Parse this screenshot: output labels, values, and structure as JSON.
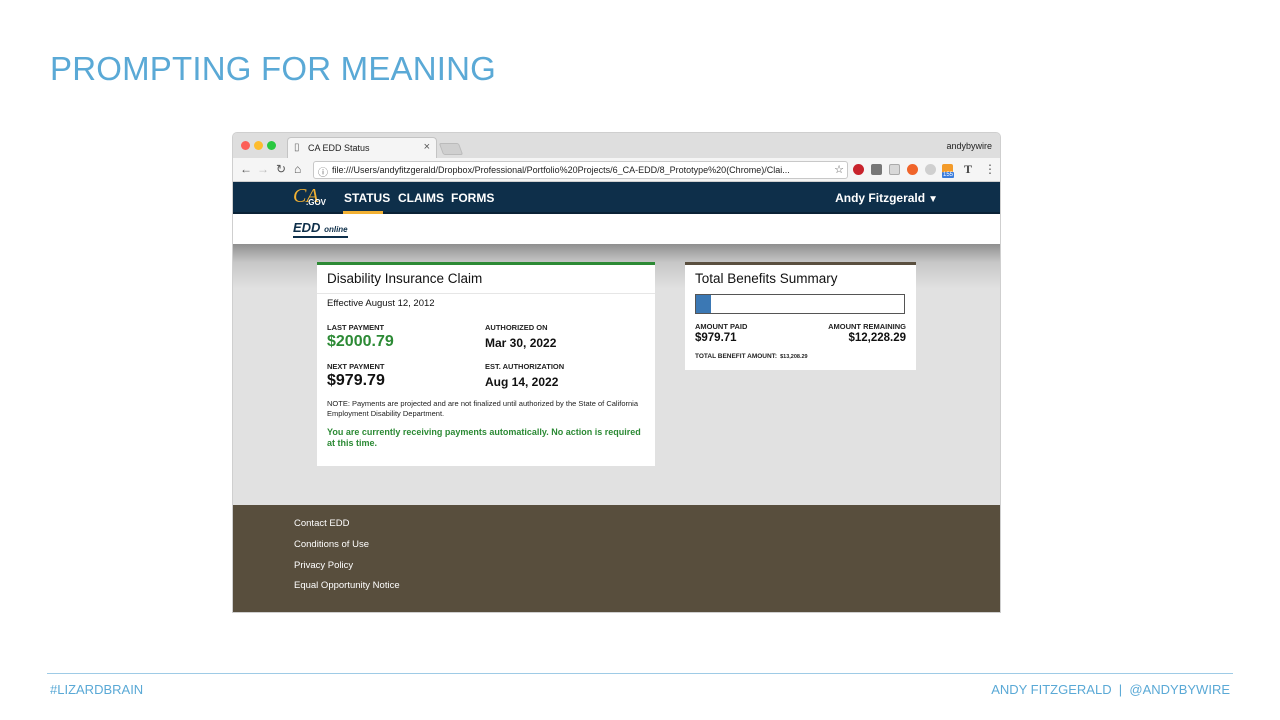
{
  "slide": {
    "title": "PROMPTING FOR MEANING",
    "footer_left": "#LIZARDBRAIN",
    "footer_right": "ANDY FITZGERALD  |  @ANDYBYWIRE"
  },
  "browser": {
    "tab_title": "CA EDD Status",
    "tab_close": "×",
    "profile_name": "andybywire",
    "url": "file:///Users/andyfitzgerald/Dropbox/Professional/Portfolio%20Projects/6_CA-EDD/8_Prototype%20(Chrome)/Clai...",
    "ext_badge": "155"
  },
  "site": {
    "logo_ca": "CA",
    "logo_gov": ".GOV",
    "nav": {
      "status": "STATUS",
      "claims": "CLAIMS",
      "forms": "FORMS"
    },
    "user_name": "Andy Fitzgerald",
    "edd_logo": "EDD",
    "edd_logo_suffix": "online"
  },
  "claim_card": {
    "title": "Disability Insurance Claim",
    "effective": "Effective August 12, 2012",
    "last_payment_label": "LAST PAYMENT",
    "last_payment_value": "$2000.79",
    "authorized_on_label": "AUTHORIZED ON",
    "authorized_on_value": "Mar 30, 2022",
    "next_payment_label": "NEXT PAYMENT",
    "next_payment_value": "$979.79",
    "est_auth_label": "EST. AUTHORIZATION",
    "est_auth_value": "Aug 14, 2022",
    "note": "NOTE: Payments are projected and are not finalized until authorized by the State of California Employment Disability Department.",
    "auto_message": "You are currently receiving payments automatically. No action is required at this time."
  },
  "benefits_card": {
    "title": "Total Benefits Summary",
    "progress_fraction": 0.074,
    "amount_paid_label": "AMOUNT PAID",
    "amount_paid_value": "$979.71",
    "amount_remaining_label": "AMOUNT REMAINING",
    "amount_remaining_value": "$12,228.29",
    "total_label": "TOTAL BENEFIT AMOUNT:",
    "total_value": "$13,208.29"
  },
  "footer_links": [
    "Contact EDD",
    "Conditions of Use",
    "Privacy Policy",
    "Equal Opportunity Notice"
  ],
  "colors": {
    "accent_blue": "#5aa9d6",
    "nav_navy": "#0e2f4a",
    "gold": "#f2b133",
    "green": "#2c8a35",
    "footer_brown": "#584e3d",
    "progress_blue": "#3b78b4"
  }
}
